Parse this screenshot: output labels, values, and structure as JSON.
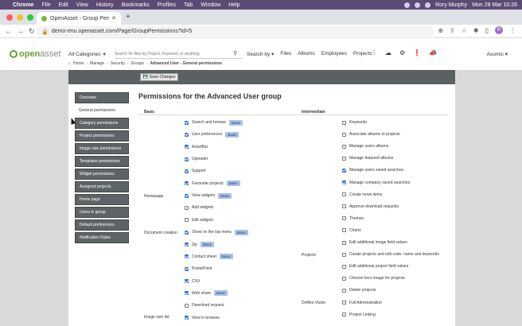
{
  "os_menubar": {
    "app": "Chrome",
    "items": [
      "File",
      "Edit",
      "View",
      "History",
      "Bookmarks",
      "Profiles",
      "Tab",
      "Window",
      "Help"
    ],
    "user": "Rory Murphy",
    "datetime": "Mon 28 Mar 10:26"
  },
  "browser": {
    "tab_title": "OpenAsset - Group Permissions",
    "url": "demo-rmu.openasset.com/Page/GroupPermissions?id=5"
  },
  "header": {
    "logo_open": "open",
    "logo_asset": "asset",
    "category_label": "All Categories",
    "search_placeholder": "Search for files by Project, Keyword, or anything",
    "search_by": "Search by ▾",
    "nav": [
      "Files",
      "Albums",
      "Employees",
      "Projects"
    ],
    "user_menu": "Asomic ▾"
  },
  "breadcrumb": [
    "Home",
    "Manage",
    "Security",
    "Groups",
    "Advanced User - General permissions"
  ],
  "toolbar": {
    "save_label": "Save Changes"
  },
  "sidebar": [
    {
      "label": "Overview",
      "active": false
    },
    {
      "label": "General permissions",
      "active": true
    },
    {
      "label": "Category permissions",
      "active": false
    },
    {
      "label": "Project permissions",
      "active": false
    },
    {
      "label": "Image size permissions",
      "active": false
    },
    {
      "label": "Templates permissions",
      "active": false
    },
    {
      "label": "Widget permissions",
      "active": false
    },
    {
      "label": "Assigned projects",
      "active": false
    },
    {
      "label": "Home page",
      "active": false
    },
    {
      "label": "Users in group",
      "active": false
    },
    {
      "label": "Default preferences",
      "active": false
    },
    {
      "label": "Notification Rules",
      "active": false
    }
  ],
  "page_title": "Permissions for the Advanced User group",
  "columns": {
    "basic": "Basic",
    "intermediate": "Intermediate"
  },
  "groups": {
    "homepage": "Homepage",
    "document_creation": "Document creation",
    "image_size_list": "Image size list",
    "projects": "Projects",
    "defiles_vision": "Defiles Vision"
  },
  "badge_label": "Basic",
  "basic_permissions": [
    {
      "label": "Search and browse",
      "checked": true,
      "badge": true
    },
    {
      "label": "User preferences",
      "checked": true,
      "badge": true
    },
    {
      "label": "AssetBar",
      "checked": true,
      "badge": false
    },
    {
      "label": "Uploader",
      "checked": true,
      "badge": false
    },
    {
      "label": "Support",
      "checked": true,
      "badge": false
    },
    {
      "label": "Favourite projects",
      "checked": true,
      "badge": true
    },
    {
      "label": "View widgets",
      "checked": true,
      "badge": true
    },
    {
      "label": "Add widgets",
      "checked": false,
      "badge": false
    },
    {
      "label": "Edit widgets",
      "checked": false,
      "badge": false
    },
    {
      "label": "Show on the top menu",
      "checked": true,
      "badge": true
    },
    {
      "label": "Zip",
      "checked": true,
      "badge": true
    },
    {
      "label": "Contact sheet",
      "checked": true,
      "badge": true
    },
    {
      "label": "PowerPoint",
      "checked": true,
      "badge": false
    },
    {
      "label": "CSV",
      "checked": true,
      "badge": false
    },
    {
      "label": "Web share",
      "checked": true,
      "badge": true
    },
    {
      "label": "Download request",
      "checked": false,
      "badge": false
    },
    {
      "label": "View in browser",
      "checked": true,
      "badge": false
    }
  ],
  "intermediate_permissions": [
    {
      "label": "Keywords",
      "checked": false
    },
    {
      "label": "Associate albums to projects",
      "checked": false
    },
    {
      "label": "Manage users albums",
      "checked": false
    },
    {
      "label": "Manage featured albums",
      "checked": false
    },
    {
      "label": "Manage users saved searches",
      "checked": true
    },
    {
      "label": "Manage company saved searches",
      "checked": true
    },
    {
      "label": "Create news items",
      "checked": false
    },
    {
      "label": "Approve download requests",
      "checked": false
    },
    {
      "label": "Themes",
      "checked": false
    },
    {
      "label": "Charts",
      "checked": false
    },
    {
      "label": "Edit additional image field values",
      "checked": false
    },
    {
      "label": "Create projects and edit code, name and keywords",
      "checked": false
    },
    {
      "label": "Edit additional project field values",
      "checked": false
    },
    {
      "label": "Choose hero image for projects",
      "checked": false
    },
    {
      "label": "Delete projects",
      "checked": false
    },
    {
      "label": "Full Administration",
      "checked": false
    },
    {
      "label": "Project Linking",
      "checked": false
    }
  ]
}
